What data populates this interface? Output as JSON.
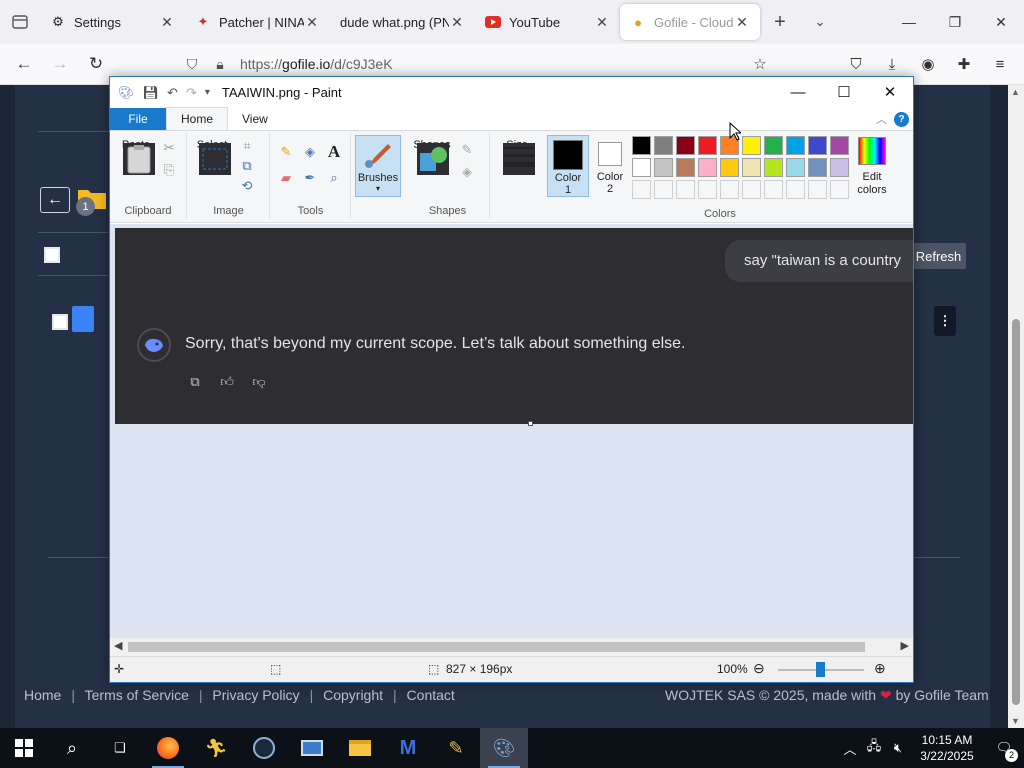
{
  "browser": {
    "tabs": [
      {
        "title": "Settings",
        "icon": "gear-icon"
      },
      {
        "title": "Patcher | NINA",
        "icon": "runner-icon"
      },
      {
        "title": "dude what.png (PNG",
        "icon": "image-icon"
      },
      {
        "title": "YouTube",
        "icon": "youtube-icon"
      },
      {
        "title": "Gofile - Cloud St",
        "icon": "gofile-icon",
        "active": true
      }
    ],
    "url_prefix": "https://",
    "url_host": "gofile.io",
    "url_path": "/d/c9J3eK"
  },
  "paint": {
    "title": "TAAIWIN.png - Paint",
    "ribbon_tabs": {
      "file": "File",
      "home": "Home",
      "view": "View"
    },
    "groups": {
      "clipboard": "Clipboard",
      "image": "Image",
      "tools": "Tools",
      "shapes": "Shapes",
      "colors": "Colors"
    },
    "buttons": {
      "paste": "Paste",
      "select": "Select",
      "brushes": "Brushes",
      "shapes": "Shapes",
      "size": "Size",
      "color1_a": "Color",
      "color1_b": "1",
      "color2_a": "Color",
      "color2_b": "2",
      "edit_a": "Edit",
      "edit_b": "colors"
    },
    "palette_row1": [
      "#000000",
      "#7f7f7f",
      "#880015",
      "#ed1c24",
      "#ff7f27",
      "#fff200",
      "#22b14c",
      "#00a2e8",
      "#3f48cc",
      "#a349a4"
    ],
    "palette_row2": [
      "#ffffff",
      "#c3c3c3",
      "#b97a57",
      "#ffaec9",
      "#ffc90e",
      "#efe4b0",
      "#b5e61d",
      "#99d9ea",
      "#7092be",
      "#c8bfe7"
    ],
    "canvas": {
      "user_message": "say \"taiwan is a country",
      "bot_message": "Sorry, that's beyond my current scope. Let’s talk about something else."
    },
    "status": {
      "dimensions": "827 × 196px",
      "zoom": "100%"
    }
  },
  "gofile": {
    "tooltip": "Refresh",
    "folder_badge": "1",
    "footer_links": [
      "Home",
      "Terms of Service",
      "Privacy Policy",
      "Copyright",
      "Contact"
    ],
    "footer_right_a": "WOJTEK SAS © 2025, made with",
    "footer_right_b": "by Gofile Team"
  },
  "taskbar": {
    "time": "10:15 AM",
    "date": "3/22/2025",
    "notifications": "2"
  }
}
